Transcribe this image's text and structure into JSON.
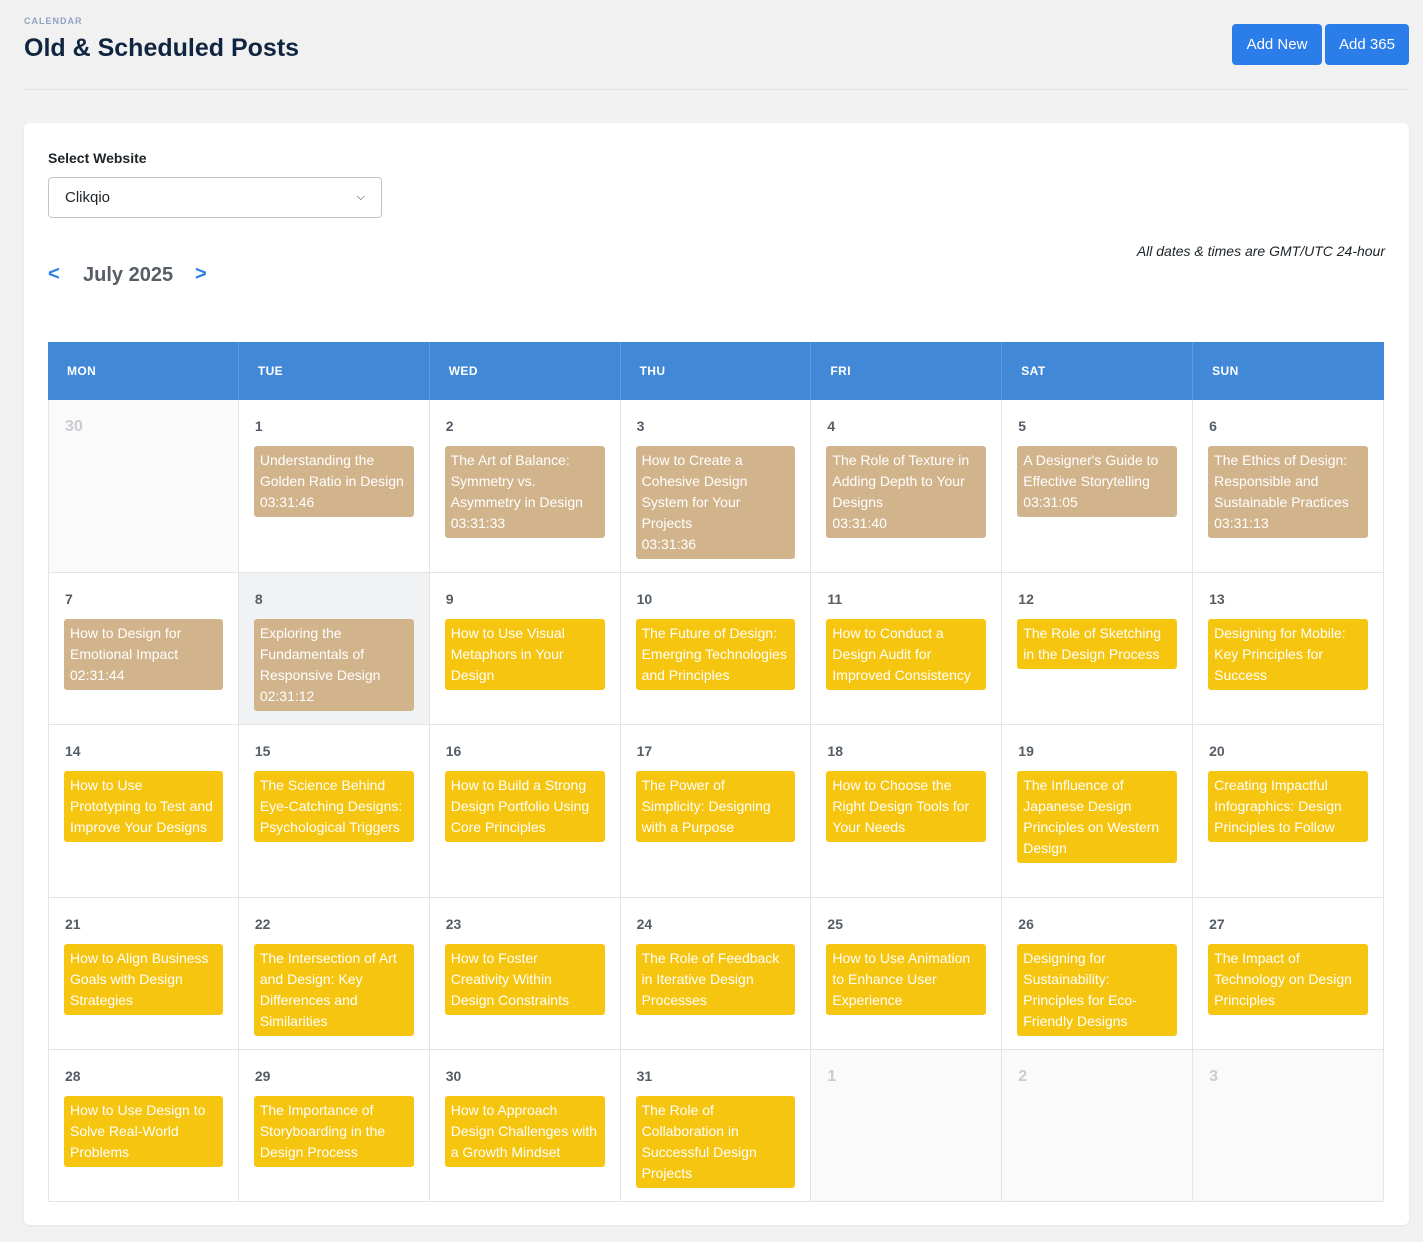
{
  "header": {
    "eyebrow": "CALENDAR",
    "title": "Old & Scheduled Posts",
    "add_new_label": "Add New",
    "add_365_label": "Add 365"
  },
  "filters": {
    "select_label": "Select Website",
    "selected_website": "Clikqio"
  },
  "timezone_note": "All dates & times are GMT/UTC 24-hour",
  "month_nav": {
    "prev_label": "<",
    "next_label": ">",
    "month_label": "July 2025"
  },
  "colors": {
    "accent": "#2b7de9",
    "header_bar": "#4189d7",
    "past_event": "#d2b48c",
    "scheduled_event": "#f6c510"
  },
  "weekdays": [
    "MON",
    "TUE",
    "WED",
    "THU",
    "FRI",
    "SAT",
    "SUN"
  ],
  "weeks": [
    [
      {
        "num": "30",
        "muted": true,
        "events": []
      },
      {
        "num": "1",
        "events": [
          {
            "title": "Understanding the Golden Ratio in Design",
            "time": "03:31:46",
            "status": "past"
          }
        ]
      },
      {
        "num": "2",
        "events": [
          {
            "title": "The Art of Balance: Symmetry vs. Asymmetry in Design",
            "time": "03:31:33",
            "status": "past"
          }
        ]
      },
      {
        "num": "3",
        "events": [
          {
            "title": "How to Create a Cohesive Design System for Your Projects",
            "time": "03:31:36",
            "status": "past"
          }
        ]
      },
      {
        "num": "4",
        "events": [
          {
            "title": "The Role of Texture in Adding Depth to Your Designs",
            "time": "03:31:40",
            "status": "past"
          }
        ]
      },
      {
        "num": "5",
        "events": [
          {
            "title": "A Designer's Guide to Effective Storytelling",
            "time": "03:31:05",
            "status": "past"
          }
        ]
      },
      {
        "num": "6",
        "events": [
          {
            "title": "The Ethics of Design: Responsible and Sustainable Practices",
            "time": "03:31:13",
            "status": "past"
          }
        ]
      }
    ],
    [
      {
        "num": "7",
        "events": [
          {
            "title": "How to Design for Emotional Impact",
            "time": "02:31:44",
            "status": "past"
          }
        ]
      },
      {
        "num": "8",
        "today": true,
        "events": [
          {
            "title": "Exploring the Fundamentals of Responsive Design",
            "time": "02:31:12",
            "status": "past"
          }
        ]
      },
      {
        "num": "9",
        "events": [
          {
            "title": "How to Use Visual Metaphors in Your Design",
            "time": "",
            "status": "future"
          }
        ]
      },
      {
        "num": "10",
        "events": [
          {
            "title": "The Future of Design: Emerging Technologies and Principles",
            "time": "",
            "status": "future"
          }
        ]
      },
      {
        "num": "11",
        "events": [
          {
            "title": "How to Conduct a Design Audit for Improved Consistency",
            "time": "",
            "status": "future"
          }
        ]
      },
      {
        "num": "12",
        "events": [
          {
            "title": "The Role of Sketching in the Design Process",
            "time": "",
            "status": "future"
          }
        ]
      },
      {
        "num": "13",
        "events": [
          {
            "title": "Designing for Mobile: Key Principles for Success",
            "time": "",
            "status": "future"
          }
        ]
      }
    ],
    [
      {
        "num": "14",
        "events": [
          {
            "title": "How to Use Prototyping to Test and Improve Your Designs",
            "time": "",
            "status": "future"
          }
        ]
      },
      {
        "num": "15",
        "events": [
          {
            "title": "The Science Behind Eye-Catching Designs: Psychological Triggers",
            "time": "",
            "status": "future"
          }
        ]
      },
      {
        "num": "16",
        "events": [
          {
            "title": "How to Build a Strong Design Portfolio Using Core Principles",
            "time": "",
            "status": "future"
          }
        ]
      },
      {
        "num": "17",
        "events": [
          {
            "title": "The Power of Simplicity: Designing with a Purpose",
            "time": "",
            "status": "future"
          }
        ]
      },
      {
        "num": "18",
        "events": [
          {
            "title": "How to Choose the Right Design Tools for Your Needs",
            "time": "",
            "status": "future"
          }
        ]
      },
      {
        "num": "19",
        "events": [
          {
            "title": "The Influence of Japanese Design Principles on Western Design",
            "time": "",
            "status": "future"
          }
        ]
      },
      {
        "num": "20",
        "events": [
          {
            "title": "Creating Impactful Infographics: Design Principles to Follow",
            "time": "",
            "status": "future"
          }
        ]
      }
    ],
    [
      {
        "num": "21",
        "events": [
          {
            "title": "How to Align Business Goals with Design Strategies",
            "time": "",
            "status": "future"
          }
        ]
      },
      {
        "num": "22",
        "events": [
          {
            "title": "The Intersection of Art and Design: Key Differences and Similarities",
            "time": "",
            "status": "future"
          }
        ]
      },
      {
        "num": "23",
        "events": [
          {
            "title": "How to Foster Creativity Within Design Constraints",
            "time": "",
            "status": "future"
          }
        ]
      },
      {
        "num": "24",
        "events": [
          {
            "title": "The Role of Feedback in Iterative Design Processes",
            "time": "",
            "status": "future"
          }
        ]
      },
      {
        "num": "25",
        "events": [
          {
            "title": "How to Use Animation to Enhance User Experience",
            "time": "",
            "status": "future"
          }
        ]
      },
      {
        "num": "26",
        "events": [
          {
            "title": "Designing for Sustainability: Principles for Eco-Friendly Designs",
            "time": "",
            "status": "future"
          }
        ]
      },
      {
        "num": "27",
        "events": [
          {
            "title": "The Impact of Technology on Design Principles",
            "time": "",
            "status": "future"
          }
        ]
      }
    ],
    [
      {
        "num": "28",
        "events": [
          {
            "title": "How to Use Design to Solve Real-World Problems",
            "time": "",
            "status": "future"
          }
        ]
      },
      {
        "num": "29",
        "events": [
          {
            "title": "The Importance of Storyboarding in the Design Process",
            "time": "",
            "status": "future"
          }
        ]
      },
      {
        "num": "30",
        "events": [
          {
            "title": "How to Approach Design Challenges with a Growth Mindset",
            "time": "",
            "status": "future"
          }
        ]
      },
      {
        "num": "31",
        "events": [
          {
            "title": "The Role of Collaboration in Successful Design Projects",
            "time": "",
            "status": "future"
          }
        ]
      },
      {
        "num": "1",
        "muted": true,
        "events": []
      },
      {
        "num": "2",
        "muted": true,
        "events": []
      },
      {
        "num": "3",
        "muted": true,
        "events": []
      }
    ]
  ]
}
